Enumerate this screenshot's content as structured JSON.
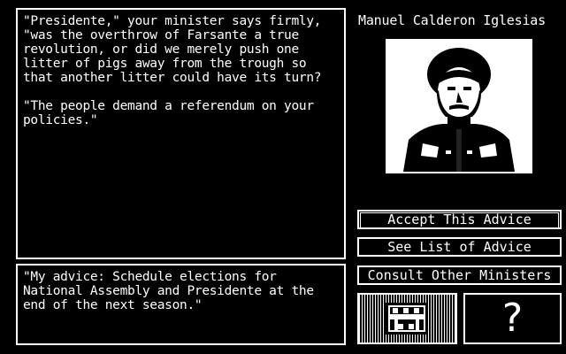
{
  "story": {
    "text": "\"Presidente,\" your minister says firmly, \"was the overthrow of Farsante a true revolution, or did we merely push one litter of pigs away from the trough so that another litter could have its turn?\n\n\"The people demand a referendum on your policies.\""
  },
  "advice": {
    "text": "\"My advice: Schedule elections for National Assembly and Presidente at the end of the next season.\""
  },
  "minister": {
    "name": "Manuel Calderon Iglesias"
  },
  "buttons": {
    "accept": "Accept This Advice",
    "list": "See List of Advice",
    "consult": "Consult Other Ministers",
    "help": "?"
  },
  "icons": {
    "cabinet": "cabinet-meeting-icon",
    "help": "question-mark-icon"
  },
  "colors": {
    "background": "#000000",
    "foreground": "#ffffff"
  }
}
